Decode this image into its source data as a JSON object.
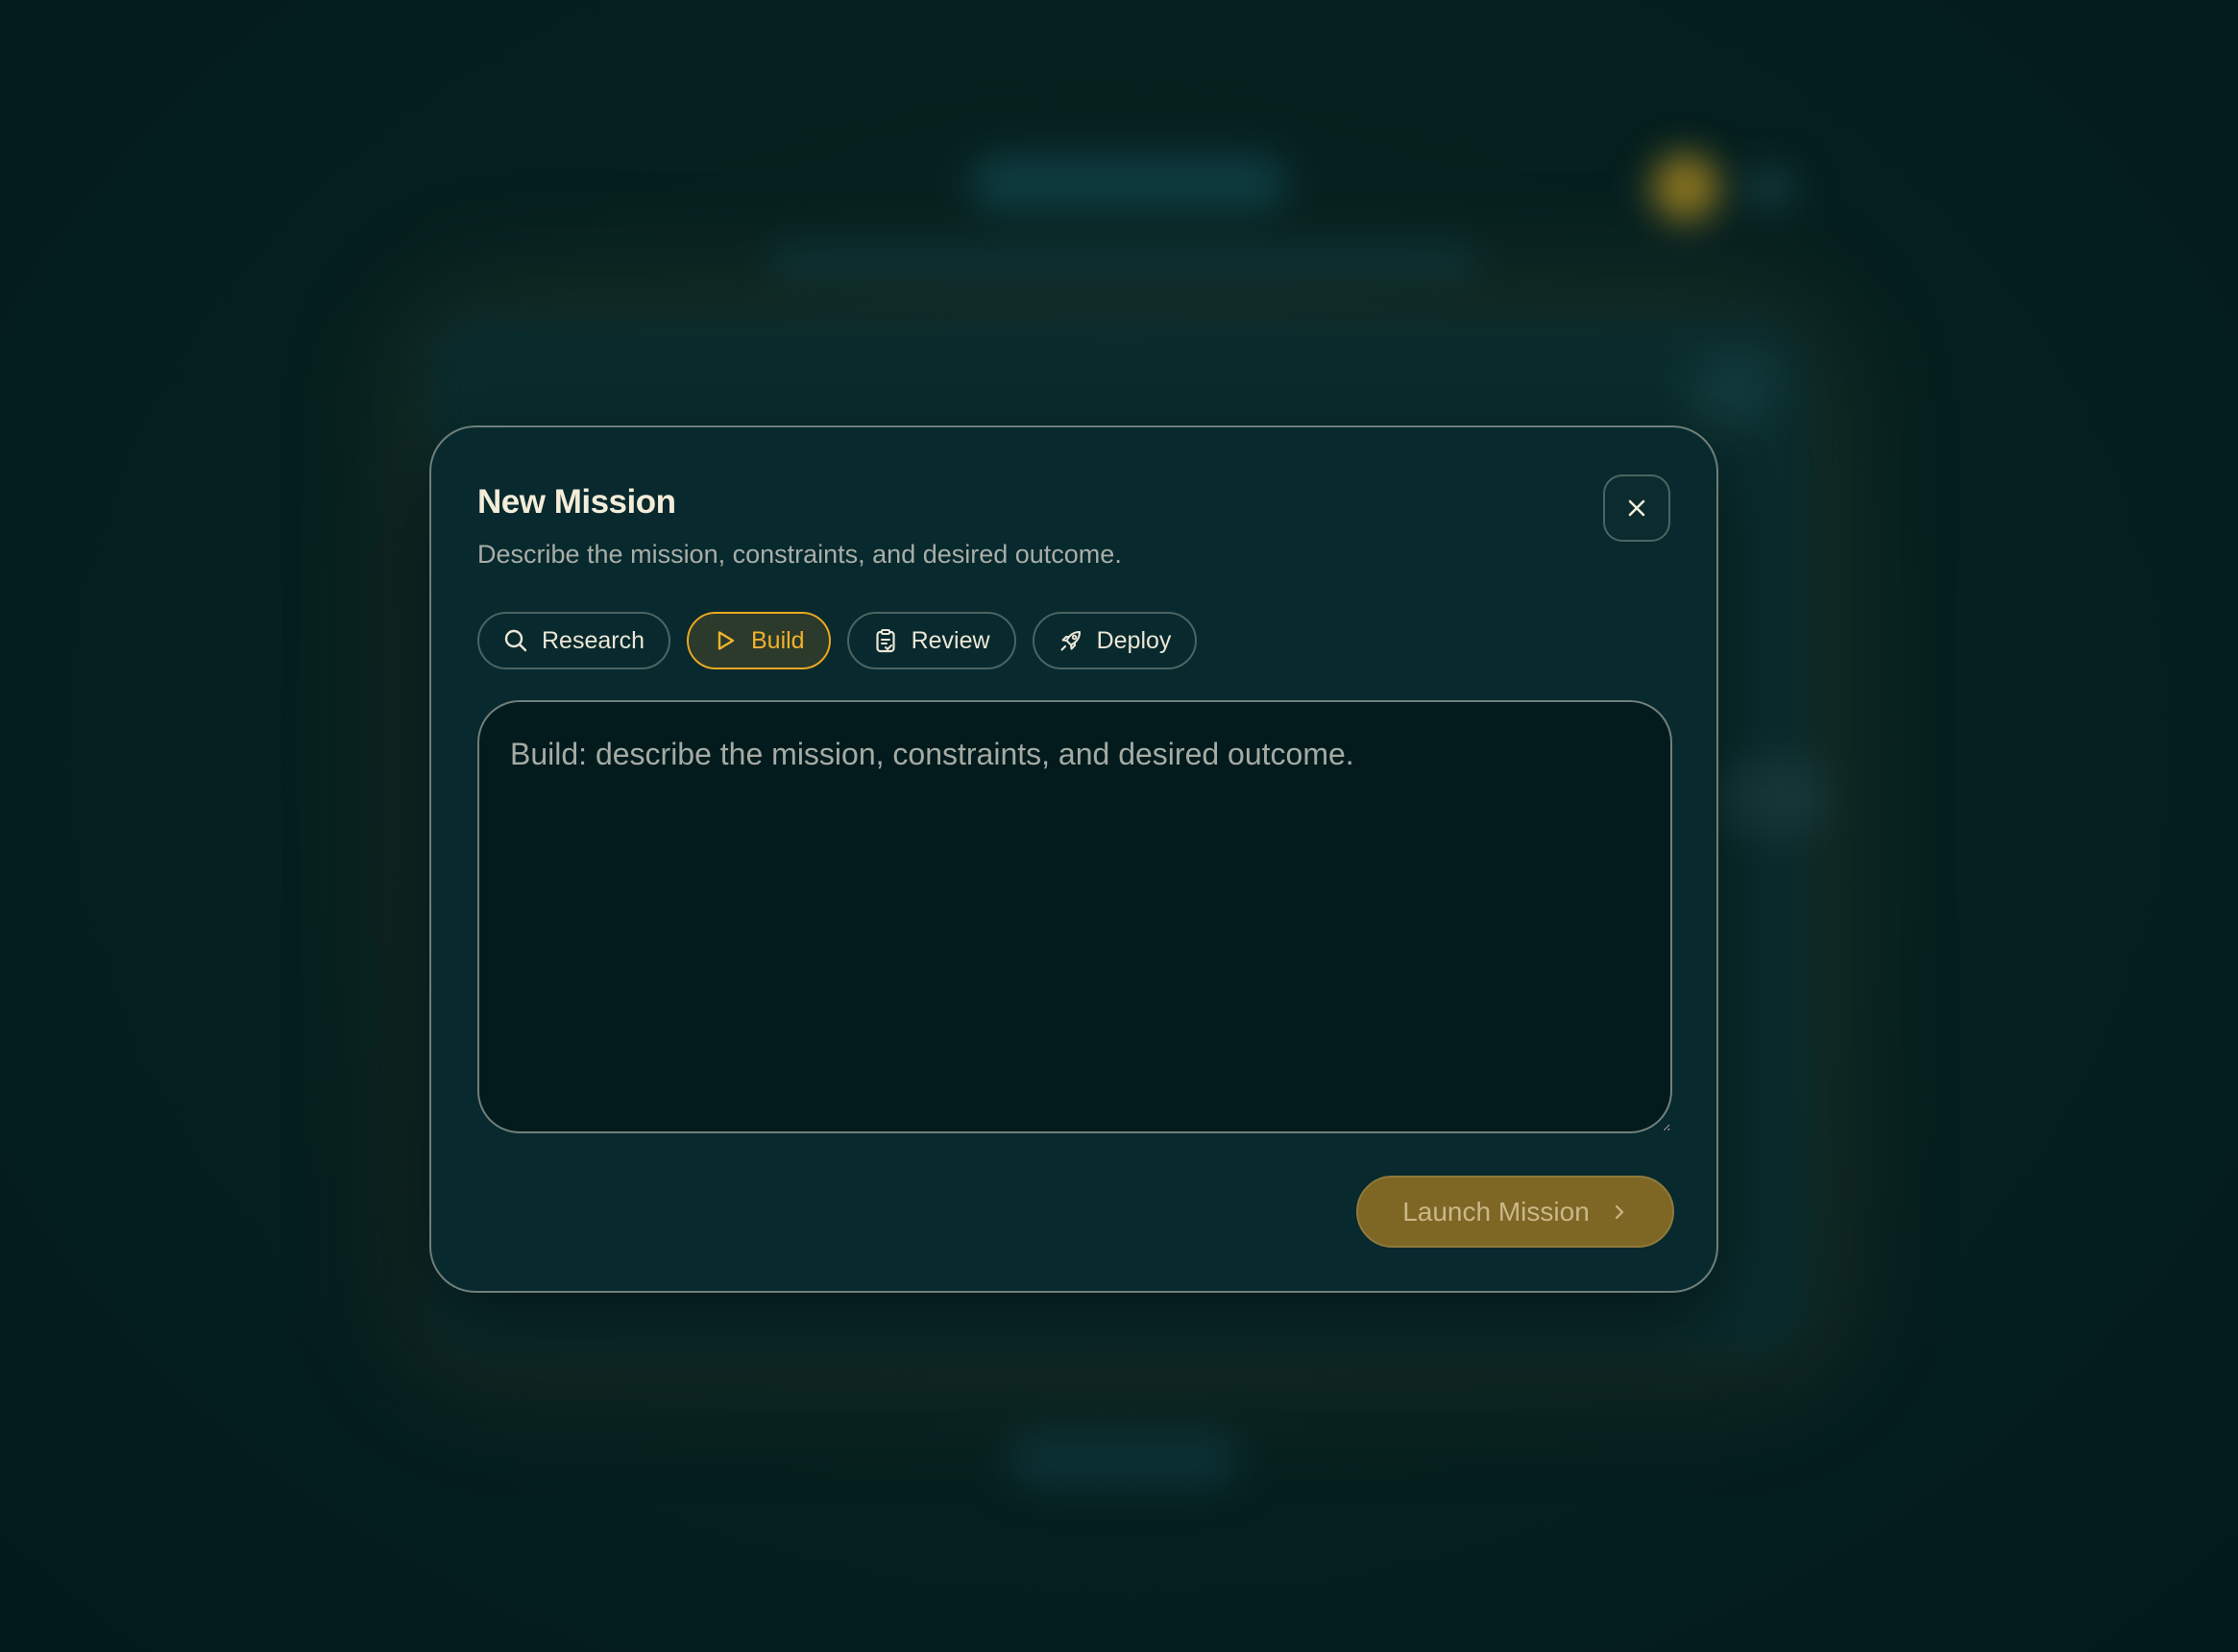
{
  "dialog": {
    "title": "New Mission",
    "subtitle": "Describe the mission, constraints, and desired outcome.",
    "close_icon": "close-icon"
  },
  "modes": [
    {
      "label": "Research",
      "icon": "search-icon",
      "active": false
    },
    {
      "label": "Build",
      "icon": "play-icon",
      "active": true
    },
    {
      "label": "Review",
      "icon": "clipboard-check-icon",
      "active": false
    },
    {
      "label": "Deploy",
      "icon": "rocket-icon",
      "active": false
    }
  ],
  "prompt": {
    "value": "",
    "placeholder": "Build: describe the mission, constraints, and desired outcome."
  },
  "launch": {
    "label": "Launch Mission",
    "icon": "chevron-right-icon"
  },
  "colors": {
    "accent": "#e9a721",
    "modal_bg": "#08292d",
    "page_bg": "#041c1f",
    "launch_bg": "#7e6625"
  }
}
